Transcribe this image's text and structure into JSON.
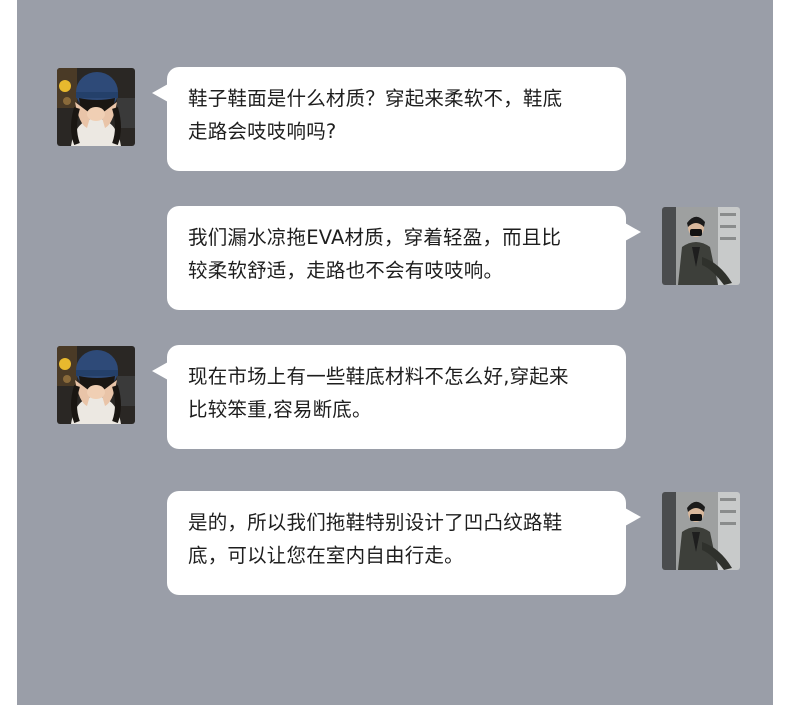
{
  "messages": [
    {
      "side": "left",
      "avatar_icon": "customer-avatar-icon",
      "lines": [
        "鞋子鞋面是什么材质？穿起来柔软不，鞋底",
        "走路会吱吱响吗?"
      ]
    },
    {
      "side": "right",
      "avatar_icon": "seller-avatar-icon",
      "lines": [
        "我们漏水凉拖EVA材质，穿着轻盈，而且比",
        "较柔软舒适，走路也不会有吱吱响。"
      ]
    },
    {
      "side": "left",
      "avatar_icon": "customer-avatar-icon",
      "lines": [
        "现在市场上有一些鞋底材料不怎么好,穿起来",
        "比较笨重,容易断底。"
      ]
    },
    {
      "side": "right",
      "avatar_icon": "seller-avatar-icon",
      "lines": [
        "是的，所以我们拖鞋特别设计了凹凸纹路鞋",
        "底，可以让您在室内自由行走。"
      ]
    }
  ],
  "colors": {
    "background": "#9a9ea8",
    "bubble": "#ffffff",
    "text": "#1e1e1e"
  }
}
